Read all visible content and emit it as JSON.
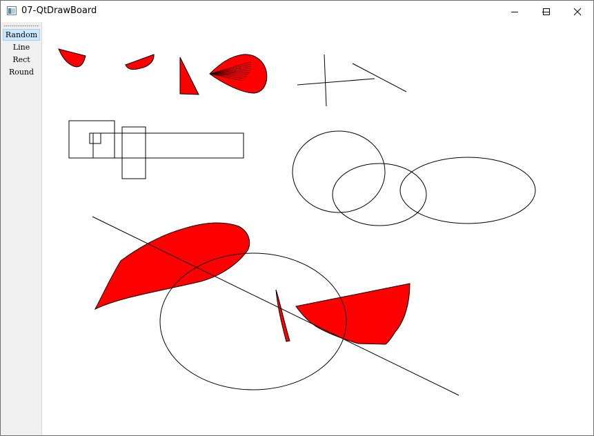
{
  "window": {
    "title": "07-QtDrawBoard",
    "controls": [
      "minimize-icon",
      "maximize-icon",
      "close-icon"
    ]
  },
  "toolbar": {
    "items": [
      {
        "label": "Random",
        "active": true
      },
      {
        "label": "Line",
        "active": false
      },
      {
        "label": "Rect",
        "active": false
      },
      {
        "label": "Round",
        "active": false
      }
    ]
  },
  "colors": {
    "fill": "#ff0000",
    "stroke": "#000000",
    "toolbar_bg": "#f0f0f0",
    "active_item": "#cce8ff"
  }
}
